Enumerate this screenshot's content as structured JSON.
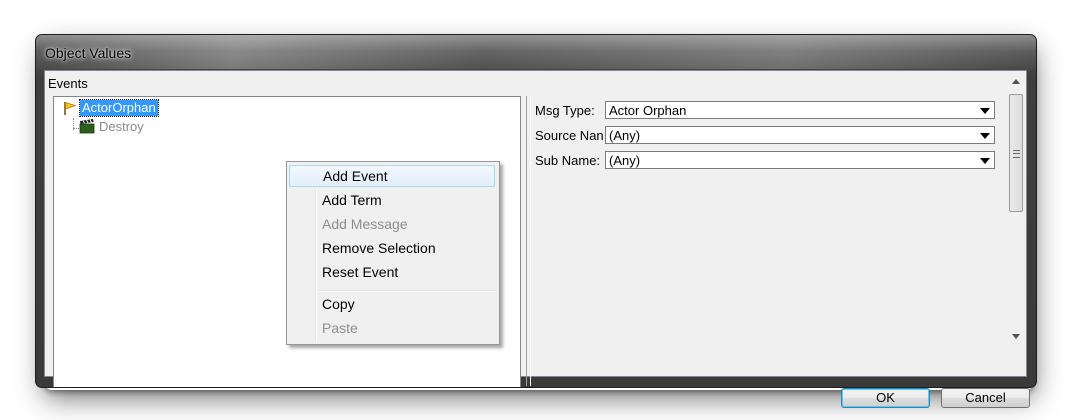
{
  "window": {
    "title": "Object Values"
  },
  "events_panel": {
    "label": "Events",
    "tree": [
      {
        "label": "ActorOrphan",
        "icon": "flag-icon",
        "selected": true
      },
      {
        "label": "Destroy",
        "icon": "clapperboard-icon",
        "selected": false
      }
    ]
  },
  "properties": {
    "msg_type": {
      "label": "Msg Type:",
      "value": "Actor Orphan"
    },
    "source_name": {
      "label": "Source Nan",
      "value": "(Any)"
    },
    "sub_name": {
      "label": "Sub Name:",
      "value": "(Any)"
    }
  },
  "buttons": {
    "ok": "OK",
    "cancel": "Cancel"
  },
  "context_menu": {
    "items": [
      {
        "label": "Add Event",
        "enabled": true,
        "highlighted": true
      },
      {
        "label": "Add Term",
        "enabled": true
      },
      {
        "label": "Add Message",
        "enabled": false
      },
      {
        "label": "Remove Selection",
        "enabled": true
      },
      {
        "label": "Reset Event",
        "enabled": true
      },
      {
        "label": "Copy",
        "enabled": true
      },
      {
        "label": "Paste",
        "enabled": false
      }
    ]
  },
  "colors": {
    "selection": "#3399ff",
    "menu_highlight": "#e2eef9",
    "ok_border": "#3c7fb1"
  }
}
